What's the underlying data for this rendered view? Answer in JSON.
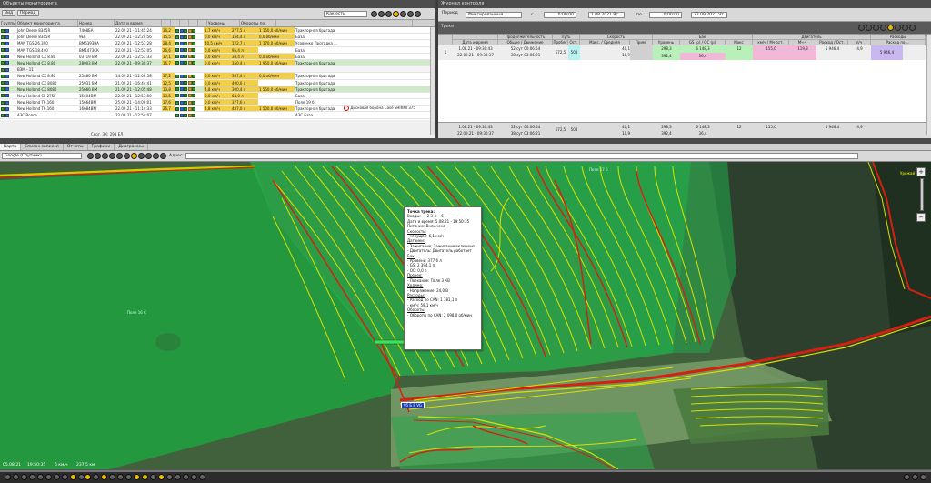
{
  "left_panel": {
    "title": "Объекты мониторинга",
    "toolbar": {
      "view_label": "Вид",
      "period_label": "Период",
      "filter_value": "Как есть"
    },
    "columns": [
      "Группы",
      "Объект мониторинга",
      "Номер",
      "Дата и время",
      "",
      "",
      "",
      "",
      "",
      "Уровень",
      "Обороты по",
      ""
    ],
    "rows": [
      {
        "name": "John Deere 8345R",
        "number": "7468ЕА",
        "datetime": "22.09.21 - 11:45:24",
        "v1": "36,2",
        "speed": "1,7 км/ч",
        "level": "277,5 л",
        "rpm": "1 150,0 об/мин",
        "extra": "Тракторная бригада",
        "style": ""
      },
      {
        "name": "John Deere 8345R",
        "number": "9ЕЕ",
        "datetime": "22.09.21 - 12:24:56",
        "v1": "15,5",
        "speed": "0,0 км/ч",
        "level": "154,4 л",
        "rpm": "0,0 об/мин",
        "extra": "База",
        "style": ""
      },
      {
        "name": "MAN TGS 26.390",
        "number": "ВМ6393ВА",
        "datetime": "22.09.21 - 12:53:28",
        "v1": "28,4",
        "speed": "40,5 км/ч",
        "level": "122,7 л",
        "rpm": "1 170,0 об/мин",
        "extra": "Усовенко Прогадка ...",
        "style": ""
      },
      {
        "name": "MAN TGS 18.440",
        "number": "ВМ1473СК",
        "datetime": "22.09.21 - 12:53:05",
        "v1": "26,6",
        "speed": "0,0 км/ч",
        "level": "95,4 л",
        "rpm": "",
        "extra": "База",
        "style": ""
      },
      {
        "name": "New Holland CX 8.80",
        "number": "03719 ВМ",
        "datetime": "22.09.21 - 12:51:33",
        "v1": "17,1",
        "speed": "0,0 км/ч",
        "level": "33,4 л",
        "rpm": "0,0 об/мин",
        "extra": "База",
        "style": ""
      },
      {
        "name": "New Holland CX 8.80",
        "number": "28903 ВМ",
        "datetime": "22.09.21 - 09:30:37",
        "v1": "16,7",
        "speed": "0,0 км/ч",
        "level": "350,4 л",
        "rpm": "1 950,0 об/мин",
        "extra": "Тракторная бригада",
        "style": "sel"
      },
      {
        "name": "ВЗМ - 11",
        "number": "",
        "datetime": "",
        "v1": "",
        "speed": "",
        "level": "",
        "rpm": "",
        "extra": "",
        "style": "sub"
      },
      {
        "name": "New Holland CX 8.80",
        "number": "25880 ВМ",
        "datetime": "14.09.21 - 12:00:58",
        "v1": "17,2",
        "speed": "0,0 км/ч",
        "level": "387,4 л",
        "rpm": "0,0 об/мин",
        "extra": "Тракторная бригада",
        "style": ""
      },
      {
        "name": "New Holland CX 8080",
        "number": "25931 ВМ",
        "datetime": "21.09.21 - 16:44:41",
        "v1": "12,5",
        "speed": "0,0 км/ч",
        "level": "400,6 л",
        "rpm": "",
        "extra": "Тракторная бригада",
        "style": ""
      },
      {
        "name": "New Holland CX 8080",
        "number": "25666 ВМ",
        "datetime": "21.09.21 - 12:05:48",
        "v1": "13,8",
        "speed": "4,8 км/ч",
        "level": "300,4 л",
        "rpm": "1 550,0 об/мин",
        "extra": "Тракторная бригада",
        "style": "sel"
      },
      {
        "name": "New Holland SF 275F",
        "number": "15604ВМ",
        "datetime": "22.09.21 - 12:53:00",
        "v1": "13,5",
        "speed": "0,0 км/ч",
        "level": "64,0 л",
        "rpm": "",
        "extra": "База",
        "style": ""
      },
      {
        "name": "New Holland T6.160",
        "number": "15664ВМ",
        "datetime": "25.09.21 - 14:00:01",
        "v1": "17,6",
        "speed": "0,0 км/ч",
        "level": "377,6 л",
        "rpm": "",
        "extra": "Поле 19 б",
        "style": ""
      },
      {
        "name": "New Holland T6.160",
        "number": "16684ВМ",
        "datetime": "22.09.21 - 11:14:33",
        "v1": "26,7",
        "speed": "4,8 км/ч",
        "level": "437,0 л",
        "rpm": "1 500,0 об/мин",
        "extra": "Тракторная бригада",
        "style": ""
      },
      {
        "name": "АЗС Волга",
        "number": "",
        "datetime": "22.09.21 - 12:54:07",
        "v1": "",
        "speed": "",
        "level": "",
        "rpm": "",
        "extra": "АЗС База",
        "style": ""
      },
      {
        "name": "АЗС Тракторная...",
        "number": "",
        "datetime": "22.09.21 - 12:58:27",
        "v1": "",
        "speed": "",
        "level": "",
        "rpm": "",
        "extra": "АЗС Бригада",
        "style": ""
      }
    ],
    "side_note": "Дисковая борона Case SHIRMI 375",
    "footer": "Серг. ЭК: 298 ЕЛ"
  },
  "right_panel": {
    "title": "Журнал контроля",
    "toolbar": {
      "period_label": "Период",
      "period_value": "Фиксированный",
      "from_label": "с",
      "time_from": "0:00:00",
      "date_from": "1.08.2021 Вс",
      "to_label": "по",
      "time_to": "0:00:00",
      "date_to": "22.09.2021 Чт"
    },
    "sub_title": "Треки",
    "group_headers": [
      {
        "label": "",
        "x": 0
      },
      {
        "label": "Продолжительность",
        "x": 0
      },
      {
        "label": "Путь",
        "x": 0
      },
      {
        "label": "Скорость",
        "x": 0
      },
      {
        "label": "Бак",
        "x": 0
      },
      {
        "label": "Двигатель",
        "x": 0
      },
      {
        "label": "Расходы",
        "x": 0
      }
    ],
    "columns": [
      "#",
      "Дата и время",
      "Общее / Движение",
      "Пробег",
      "Ост.",
      "Макс. / Средняя",
      "Прим.",
      "Уровень",
      "GS (р) / ОС (р)",
      "Макс",
      "км/ч / Мч·ост.",
      "Мч·ч",
      "Расход / Ост.",
      "л/ч",
      "Расход по ..."
    ],
    "track": {
      "index": "1",
      "date_start": "1.08.21 - 09:30:43",
      "date_end": "22.09.21 - 09:30:37",
      "dur_total": "52 сут 00:06:54",
      "dur_move": "38 сут 03:06:21",
      "mileage": "672,5",
      "stops": "504",
      "spd_max": "40,1",
      "spd_avg": "10,9",
      "level_a": "298,3",
      "level_b": "392,4",
      "gs_a": "6 148,3",
      "gs_b": "12",
      "os_a": "36,4",
      "eng_a": "155,0",
      "eng_b": "119,8",
      "eng_c": "5 946,4",
      "eng_d": "4,9",
      "cost": "5 946,4"
    },
    "totals": {
      "date_start": "1.08.21 - 09:30:43",
      "date_end": "22.09.21 - 09:30:37",
      "dur_total": "52 сут 00:06:54",
      "dur_move": "38 сут 03:06:21",
      "mileage": "672,5",
      "stops": "504",
      "spd_max": "40,1",
      "spd_avg": "10,9",
      "level_a": "298,3",
      "level_b": "392,4",
      "gs_a": "6 148,3",
      "gs_b": "12",
      "os_a": "36,4",
      "eng_a": "155,0",
      "eng_c": "5 946,4",
      "eng_d": "4,9"
    }
  },
  "tabs": [
    "Карта",
    "Список записей",
    "Отчеты",
    "Графики",
    "Диаграммы"
  ],
  "map_toolbar": {
    "provider": "Google (Спутник)",
    "address_label": "Адрес:"
  },
  "fields": {
    "f1": "Поле 16 С",
    "f2": "Поле 17 б",
    "f3": "Урожай 17"
  },
  "popup": {
    "title": "Точка трека:",
    "lines": [
      "Входы: --- 2 3 4 -- 6 -------",
      "Дата и время: 5.08.21 - 19:50:35",
      "Питание: Включено",
      "Скорость:",
      "- Текущая: 6,1 км/ч",
      "Датчики:",
      "- Зажигание, Зажигание включено",
      "- Двигатель: Двигатель работает",
      "Бак:",
      "- Уровень: 377,6 л",
      "- GS: 2 394,1 л",
      "- ОС: 0,0 л",
      "Прочее:",
      "- Поехание: Поле 3 КВ",
      "Ходимо:",
      "- Напряжение: 24,0 В",
      "Расходы:",
      "- Расход по CAN: 1 781,1 л",
      "- км/ч: 59,1 км/ч",
      "Обороты:",
      "- Обороты по CAN: 2 098,0 об/мин"
    ]
  },
  "marker_label": "95 Б 8 VG",
  "status": {
    "datetime": "05.08.21",
    "time": "19:50:35",
    "speed": "6 км/ч",
    "dist": "237,5 км"
  },
  "colors": {
    "accent": "#e6b800",
    "track_yellow": "#d8e000",
    "track_red": "#d42010",
    "field": "#2aa84f"
  }
}
